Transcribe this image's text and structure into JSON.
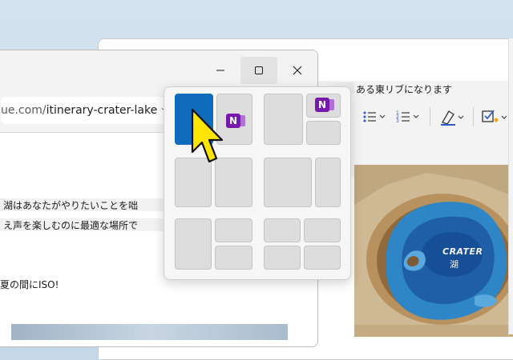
{
  "browser": {
    "url_host": "ue.com/",
    "url_path": "itinerary-crater-lake",
    "caption_buttons": {
      "minimize": "—",
      "maximize": "☐",
      "close": "✕"
    },
    "page_lines": [
      "湖はあなたがやりたいことを咄",
      "え声を楽しむのに最適な場所で",
      "夏の間にISO!"
    ]
  },
  "onenote_window": {
    "header_text": "ある東リブになります",
    "map_label_title": "CRATER",
    "map_label_sub": "湖"
  },
  "snap_layouts": {
    "selected_layout": 1,
    "selected_zone": "left-half",
    "app_icon": "onenote-icon",
    "accent_color": "#0f6cbd"
  },
  "icons": {
    "minimize": "minimize-icon",
    "maximize": "maximize-icon",
    "close": "close-icon",
    "cursor": "mouse-pointer-icon"
  }
}
